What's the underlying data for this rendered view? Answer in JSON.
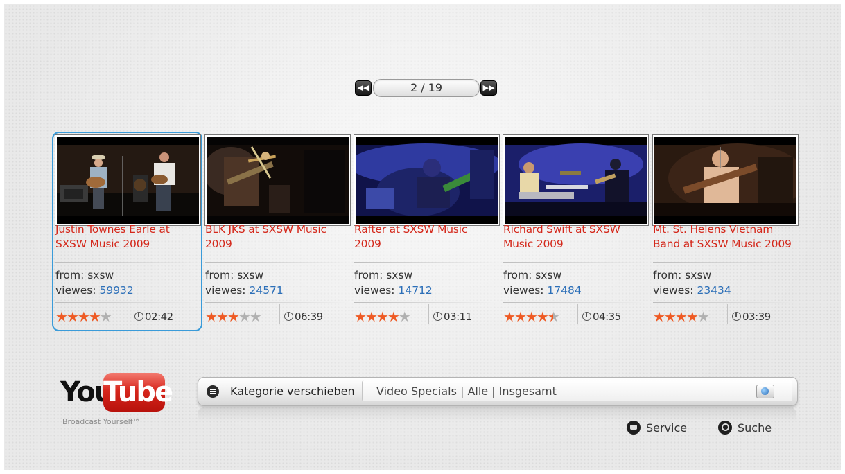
{
  "pager": {
    "current": 2,
    "total": 19,
    "label": "2 / 19",
    "prev_icon": "rewind-icon",
    "next_icon": "fast-forward-icon"
  },
  "videos": [
    {
      "title": "Justin Townes Earle at SXSW Music 2009",
      "from_label": "from:",
      "from": "sxsw",
      "views_label": "viewes:",
      "views": "59932",
      "rating": 4,
      "duration": "02:42",
      "selected": true
    },
    {
      "title": "BLK JKS at SXSW Music 2009",
      "from_label": "from:",
      "from": "sxsw",
      "views_label": "viewes:",
      "views": "24571",
      "rating": 3,
      "duration": "06:39",
      "selected": false
    },
    {
      "title": "Rafter at SXSW Music 2009",
      "from_label": "from:",
      "from": "sxsw",
      "views_label": "viewes:",
      "views": "14712",
      "rating": 4,
      "duration": "03:11",
      "selected": false
    },
    {
      "title": "Richard Swift at SXSW Music 2009",
      "from_label": "from:",
      "from": "sxsw",
      "views_label": "viewes:",
      "views": "17484",
      "rating": 4.5,
      "duration": "04:35",
      "selected": false
    },
    {
      "title": "Mt. St. Helens Vietnam Band at SXSW Music 2009",
      "from_label": "from:",
      "from": "sxsw",
      "views_label": "viewes:",
      "views": "23434",
      "rating": 4,
      "duration": "03:39",
      "selected": false
    }
  ],
  "logo": {
    "you": "You",
    "tube": "Tube",
    "tagline": "Broadcast Yourself™"
  },
  "category_bar": {
    "label": "Kategorie verschieben",
    "value": "Video Specials | Alle | Insgesamt",
    "menu_icon": "menu-icon",
    "globe_icon": "globe-icon"
  },
  "footer": {
    "service_label": "Service",
    "search_label": "Suche"
  },
  "colors": {
    "title": "#d4281b",
    "views": "#2c6fb8",
    "star_on": "#ee5a24",
    "star_off": "#b0b0b0",
    "focus": "#3a9bd9",
    "logo_red": "#d7261c"
  }
}
